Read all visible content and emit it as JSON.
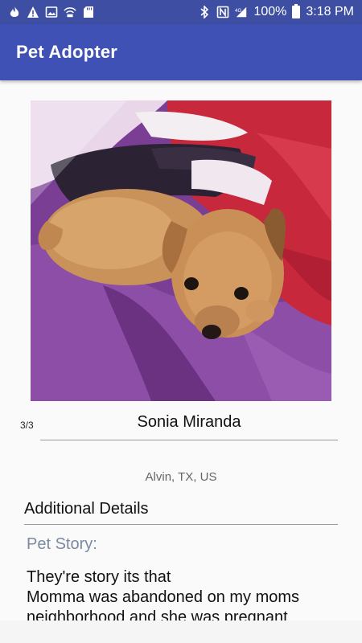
{
  "status_bar": {
    "battery_percent": "100%",
    "time": "3:18 PM",
    "left_icons": [
      "flame-icon",
      "warning-icon",
      "image-icon",
      "wifi-calling-icon",
      "sd-card-icon"
    ],
    "right_icons": [
      "bluetooth-icon",
      "nfc-icon",
      "signal-icon",
      "battery-icon"
    ]
  },
  "app_bar": {
    "title": "Pet Adopter",
    "color": "#3f51b5"
  },
  "pet": {
    "photo_counter": "3/3",
    "name": "Sonia Miranda",
    "location": "Alvin, TX, US",
    "photo_alt": "puppy-photo"
  },
  "details": {
    "heading": "Additional Details",
    "story_label": "Pet Story:",
    "story_text": "They're story its that\nMomma was abandoned on my moms\nneighborhood and she was pregnant"
  }
}
